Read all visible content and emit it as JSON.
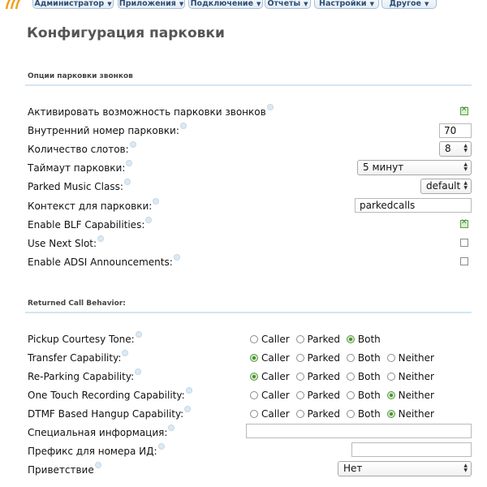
{
  "nav": {
    "items": [
      {
        "label": "Администратор"
      },
      {
        "label": "Приложения"
      },
      {
        "label": "Подключение"
      },
      {
        "label": "Отчеты"
      },
      {
        "label": "Настройки"
      },
      {
        "label": "Другое"
      }
    ],
    "caret": "▼"
  },
  "page": {
    "title": "Конфигурация парковки"
  },
  "section1": {
    "title": "Опции парковки звонков",
    "fields": {
      "enable_parking": {
        "label": "Активировать возможность парковки звонков",
        "checked": true
      },
      "parking_extension": {
        "label": "Внутренний номер парковки:",
        "value": "70"
      },
      "slots": {
        "label": "Количество слотов:",
        "value": "8"
      },
      "timeout": {
        "label": "Таймаут парковки:",
        "value": "5 минут"
      },
      "music_class": {
        "label": "Parked Music Class:",
        "value": "default"
      },
      "context": {
        "label": "Контекст для парковки:",
        "value": "parkedcalls"
      },
      "blf": {
        "label": "Enable BLF Capabilities:",
        "checked": true
      },
      "next_slot": {
        "label": "Use Next Slot:",
        "checked": false
      },
      "adsi": {
        "label": "Enable ADSI Announcements:",
        "checked": false
      }
    }
  },
  "section2": {
    "title": "Returned Call Behavior:",
    "options": {
      "caller": "Caller",
      "parked": "Parked",
      "both": "Both",
      "neither": "Neither"
    },
    "pickup": {
      "label": "Pickup Courtesy Tone:",
      "selected": "Both"
    },
    "transfer": {
      "label": "Transfer Capability:",
      "selected": "Caller"
    },
    "reparking": {
      "label": "Re-Parking Capability:",
      "selected": "Caller"
    },
    "recording": {
      "label": "One Touch Recording Capability:",
      "selected": "Neither"
    },
    "dtmf": {
      "label": "DTMF Based Hangup Capability:",
      "selected": "Neither"
    },
    "special_info": {
      "label": "Специальная информация:",
      "value": ""
    },
    "cid_prefix": {
      "label": "Префикс для номера ИД:",
      "value": ""
    },
    "greeting": {
      "label": "Приветствие",
      "value": "Нет"
    }
  },
  "colors": {
    "accent": "#2d4e73",
    "check": "#5e9a4a",
    "section_line": "#d5e5f2"
  },
  "icons": [
    "app-logo-icon",
    "help-dot-icon",
    "spinner-arrows-icon"
  ]
}
